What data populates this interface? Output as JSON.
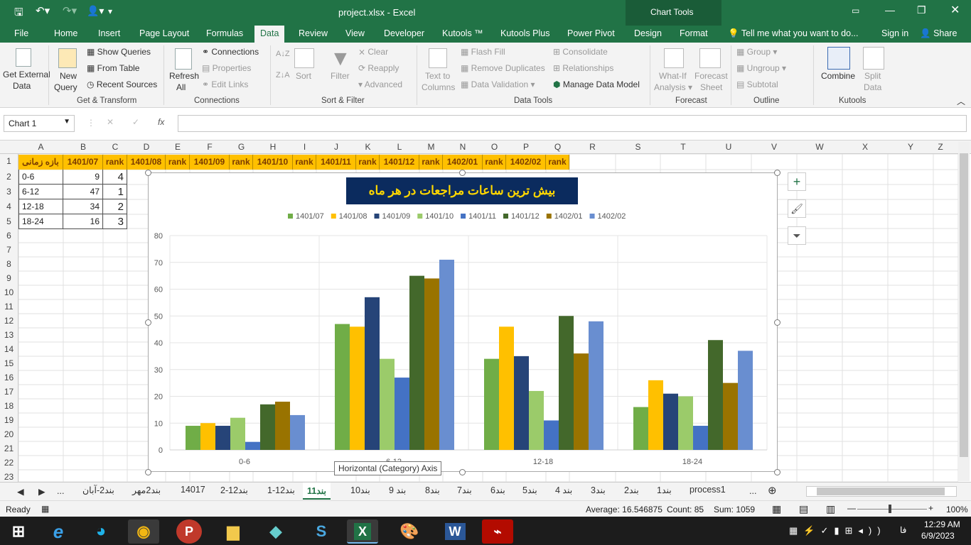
{
  "title_bar": {
    "title": "project.xlsx - Excel",
    "context": "Chart Tools"
  },
  "tabs": [
    "File",
    "Home",
    "Insert",
    "Page Layout",
    "Formulas",
    "Data",
    "Review",
    "View",
    "Developer",
    "Kutools ™",
    "Kutools Plus",
    "Power Pivot",
    "Design",
    "Format"
  ],
  "tell_me": "Tell me what you want to do...",
  "sign_in": "Sign in",
  "share": "Share",
  "ribbon": {
    "get_external": "Get External",
    "data": "Data",
    "new": "New",
    "query": "Query",
    "show_queries": "Show Queries",
    "from_table": "From Table",
    "recent_sources": "Recent Sources",
    "g_transform": "Get & Transform",
    "refresh": "Refresh",
    "all": "All",
    "connections": "Connections",
    "properties": "Properties",
    "edit_links": "Edit Links",
    "g_connections": "Connections",
    "sort": "Sort",
    "filter": "Filter",
    "clear": "Clear",
    "reapply": "Reapply",
    "advanced": "Advanced",
    "g_sort": "Sort & Filter",
    "text_to": "Text to",
    "columns": "Columns",
    "flash_fill": "Flash Fill",
    "remove_dup": "Remove Duplicates",
    "data_val": "Data Validation",
    "consolidate": "Consolidate",
    "relationships": "Relationships",
    "manage_dm": "Manage Data Model",
    "g_tools": "Data Tools",
    "what_if": "What-If",
    "analysis": "Analysis",
    "forecast": "Forecast",
    "sheet": "Sheet",
    "g_forecast": "Forecast",
    "group": "Group",
    "ungroup": "Ungroup",
    "subtotal": "Subtotal",
    "g_outline": "Outline",
    "combine": "Combine",
    "split": "Split",
    "split_data": "Data",
    "g_kutools": "Kutools"
  },
  "name_box": "Chart 1",
  "fx": "fx",
  "columns": [
    "A",
    "B",
    "C",
    "D",
    "E",
    "F",
    "G",
    "H",
    "I",
    "J",
    "K",
    "L",
    "M",
    "N",
    "O",
    "P",
    "Q",
    "R",
    "S",
    "T",
    "U",
    "V",
    "W",
    "X",
    "Y",
    "Z"
  ],
  "rows": [
    "1",
    "2",
    "3",
    "4",
    "5",
    "6",
    "7",
    "8",
    "9",
    "10",
    "11",
    "12",
    "13",
    "14",
    "15",
    "16",
    "17",
    "18",
    "19",
    "20",
    "21",
    "22",
    "23"
  ],
  "header_row": [
    "بازه زمانی",
    "1401/07",
    "rank",
    "1401/08",
    "rank",
    "1401/09",
    "rank",
    "1401/10",
    "rank",
    "1401/11",
    "rank",
    "1401/12",
    "rank",
    "1402/01",
    "rank",
    "1402/02",
    "rank"
  ],
  "cells": [
    [
      "0-6",
      "9",
      "4"
    ],
    [
      "6-12",
      "47",
      "1"
    ],
    [
      "12-18",
      "34",
      "2"
    ],
    [
      "18-24",
      "16",
      "3"
    ]
  ],
  "chart_data": {
    "type": "bar",
    "title": "بیش ترین ساعات مراجعات در هر ماه",
    "categories": [
      "0-6",
      "6-12",
      "12-18",
      "18-24"
    ],
    "ylim": [
      0,
      80
    ],
    "yticks": [
      "0",
      "10",
      "20",
      "30",
      "40",
      "50",
      "60",
      "70",
      "80"
    ],
    "legend_position": "top",
    "series": [
      {
        "name": "1401/07",
        "color": "#70ad47",
        "values": [
          9,
          47,
          34,
          16
        ]
      },
      {
        "name": "1401/08",
        "color": "#ffc000",
        "values": [
          10,
          46,
          46,
          26
        ]
      },
      {
        "name": "1401/09",
        "color": "#264478",
        "values": [
          9,
          57,
          35,
          21
        ]
      },
      {
        "name": "1401/10",
        "color": "#9bcb6a",
        "values": [
          12,
          34,
          22,
          20
        ]
      },
      {
        "name": "1401/11",
        "color": "#4472c4",
        "values": [
          3,
          27,
          11,
          9
        ]
      },
      {
        "name": "1401/12",
        "color": "#43682b",
        "values": [
          17,
          65,
          50,
          41
        ]
      },
      {
        "name": "1402/01",
        "color": "#997300",
        "values": [
          18,
          64,
          36,
          25
        ]
      },
      {
        "name": "1402/02",
        "color": "#698ed0",
        "values": [
          13,
          71,
          48,
          37
        ]
      }
    ]
  },
  "tooltip": "Horizontal (Category) Axis",
  "sheet_tabs": [
    "بند2-آبان",
    "بند2مهر",
    "14017",
    "بند12-2",
    "بند12-1",
    "بند11",
    "بند10",
    "بند 9",
    "بند8",
    "بند7",
    "بند6",
    "بند5",
    "بند 4",
    "بند3",
    "بند2",
    "بند1",
    "process1"
  ],
  "active_tab": "بند11",
  "status": {
    "ready": "Ready",
    "average": "Average: 16.546875",
    "count": "Count: 85",
    "sum": "Sum: 1059",
    "zoom": "100%"
  },
  "clock": {
    "time": "12:29 AM",
    "date": "6/9/2023",
    "lang": "فا"
  }
}
